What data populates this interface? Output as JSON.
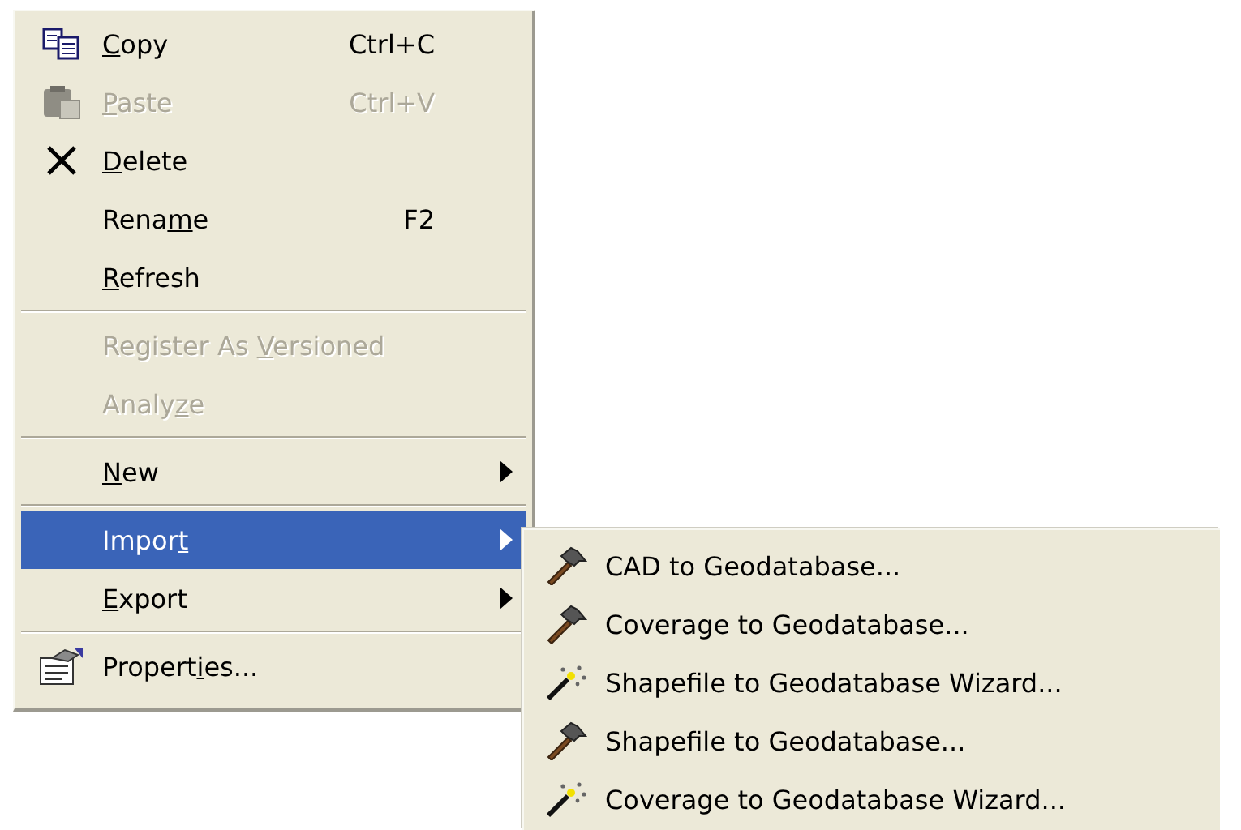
{
  "menu": {
    "items": [
      {
        "kind": "copy",
        "key": "C",
        "after": "opy",
        "shortcut": "Ctrl+C",
        "disabled": false,
        "selected": false,
        "submenu": false
      },
      {
        "kind": "paste",
        "key": "P",
        "after": "aste",
        "shortcut": "Ctrl+V",
        "disabled": true,
        "selected": false,
        "submenu": false
      },
      {
        "kind": "delete",
        "key": "D",
        "after": "elete",
        "disabled": false,
        "selected": false,
        "submenu": false
      },
      {
        "kind": "plain",
        "before": "Rena",
        "key": "m",
        "after": "e",
        "shortcut": "F2",
        "disabled": false,
        "selected": false,
        "submenu": false
      },
      {
        "kind": "plain",
        "key": "R",
        "after": "efresh",
        "disabled": false,
        "selected": false,
        "submenu": false
      },
      {
        "kind": "separator"
      },
      {
        "kind": "plain",
        "before": "Register As ",
        "key": "V",
        "after": "ersioned",
        "disabled": true,
        "selected": false,
        "submenu": false
      },
      {
        "kind": "plain",
        "before": "Analy",
        "key": "z",
        "after": "e",
        "disabled": true,
        "selected": false,
        "submenu": false
      },
      {
        "kind": "separator"
      },
      {
        "kind": "plain",
        "key": "N",
        "after": "ew",
        "disabled": false,
        "selected": false,
        "submenu": true
      },
      {
        "kind": "separator"
      },
      {
        "kind": "plain",
        "before": "Impor",
        "key": "t",
        "disabled": false,
        "selected": true,
        "submenu": true
      },
      {
        "kind": "plain",
        "key": "E",
        "after": "xport",
        "disabled": false,
        "selected": false,
        "submenu": true
      },
      {
        "kind": "separator"
      },
      {
        "kind": "properties",
        "before": "Propert",
        "key": "i",
        "after": "es...",
        "disabled": false,
        "selected": false,
        "submenu": false
      }
    ]
  },
  "submenu": {
    "items": [
      {
        "kind": "tool",
        "label": "CAD to Geodatabase..."
      },
      {
        "kind": "tool",
        "label": "Coverage to Geodatabase..."
      },
      {
        "kind": "wizard",
        "label": "Shapefile to Geodatabase Wizard..."
      },
      {
        "kind": "tool",
        "label": "Shapefile to Geodatabase..."
      },
      {
        "kind": "wizard",
        "label": "Coverage to Geodatabase Wizard..."
      }
    ]
  }
}
